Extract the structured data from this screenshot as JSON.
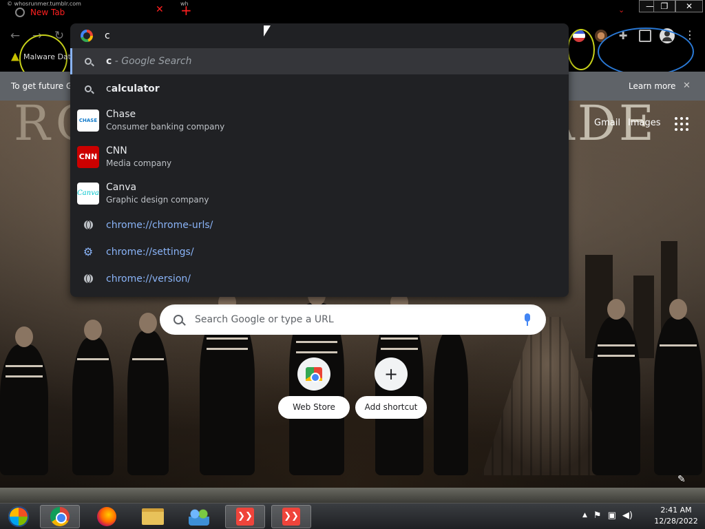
{
  "tab": {
    "title": "New Tab",
    "close_symbol": "✕",
    "new_tab_symbol": "+",
    "ghost_left": "© whosrunmer.tumblr.com",
    "ghost_right": "wh"
  },
  "window_controls": {
    "minimize": "—",
    "restore": "❐",
    "close": "✕"
  },
  "bookmarks": {
    "item": "Malware Dat"
  },
  "infobar": {
    "text": "To get future G",
    "learn_more": "Learn more",
    "close": "✕"
  },
  "omnibox": {
    "input_value": "c",
    "suggestions": [
      {
        "type": "search",
        "icon": "search-icon",
        "bold": "c",
        "rest": " - Google Search"
      },
      {
        "type": "search",
        "icon": "search-icon",
        "bold": "c",
        "rest": "alculator"
      },
      {
        "type": "entity",
        "bold": "C",
        "rest": "hase",
        "subtitle": "Consumer banking company",
        "image_text": "CHASE",
        "image_color": "#ffffff"
      },
      {
        "type": "entity",
        "bold": "C",
        "rest": "NN",
        "subtitle": "Media company",
        "image_text": "CNN",
        "image_color": "#cc0000"
      },
      {
        "type": "entity",
        "bold": "C",
        "rest": "anva",
        "subtitle": "Graphic design company",
        "image_text": "Canva",
        "image_color": "#ffffff"
      },
      {
        "type": "url",
        "icon": "globe-icon",
        "url": "chrome://chrome-urls/"
      },
      {
        "type": "url",
        "icon": "gear-icon",
        "url": "chrome://settings/"
      },
      {
        "type": "url",
        "icon": "globe-icon",
        "url": "chrome://version/"
      }
    ]
  },
  "header_links": {
    "gmail": "Gmail",
    "images": "Images"
  },
  "ntp": {
    "search_placeholder": "Search Google or type a URL",
    "shortcuts": [
      {
        "label": "Web Store",
        "icon": "webstore-icon"
      },
      {
        "label": "Add shortcut",
        "icon": "plus-icon",
        "symbol": "+"
      }
    ]
  },
  "background": {
    "text_left": "RC",
    "text_right": "ADE"
  },
  "taskbar": {
    "apps": [
      "start-orb",
      "chrome",
      "firefox",
      "file-explorer",
      "network-people",
      "anydesk",
      "anydesk"
    ],
    "anydesk_symbol": "❯❯",
    "clock_time": "2:41 AM",
    "clock_date": "12/28/2022",
    "tray_icons": [
      "chevron-up-icon",
      "flag-icon",
      "network-icon",
      "volume-icon"
    ]
  }
}
